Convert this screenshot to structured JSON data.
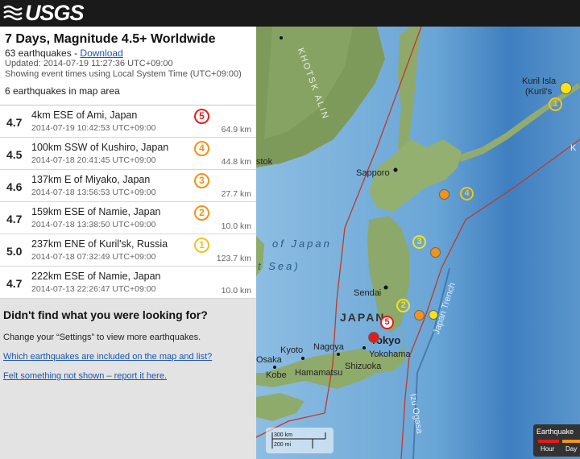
{
  "header": {
    "logo_text": "USGS"
  },
  "summary": {
    "title": "7 Days, Magnitude 4.5+ Worldwide",
    "count_text": "63 earthquakes - ",
    "download_label": "Download",
    "updated": "Updated: 2014-07-19 11:27:36 UTC+09:00",
    "timezone": "Showing event times using Local System Time (UTC+09:00)",
    "in_map_area": "6 earthquakes in map area"
  },
  "earthquakes": [
    {
      "mag": "4.7",
      "place": "4km ESE of Ami, Japan",
      "time": "2014-07-19 10:42:53 UTC+09:00",
      "depth": "64.9 km",
      "num": "5",
      "color": "#e02020"
    },
    {
      "mag": "4.5",
      "place": "100km SSW of Kushiro, Japan",
      "time": "2014-07-18 20:41:45 UTC+09:00",
      "depth": "44.8 km",
      "num": "4",
      "color": "#f39317"
    },
    {
      "mag": "4.6",
      "place": "137km E of Miyako, Japan",
      "time": "2014-07-18 13:56:53 UTC+09:00",
      "depth": "27.7 km",
      "num": "3",
      "color": "#f39317"
    },
    {
      "mag": "4.7",
      "place": "159km ESE of Namie, Japan",
      "time": "2014-07-18 13:38:50 UTC+09:00",
      "depth": "10.0 km",
      "num": "2",
      "color": "#f39317"
    },
    {
      "mag": "5.0",
      "place": "237km ENE of Kuril'sk, Russia",
      "time": "2014-07-18 07:32:49 UTC+09:00",
      "depth": "123.7 km",
      "num": "1",
      "color": "#f3c317"
    },
    {
      "mag": "4.7",
      "place": "222km ESE of Namie, Japan",
      "time": "2014-07-13 22:26:47 UTC+09:00",
      "depth": "10.0 km",
      "num": "",
      "color": "#f3c317"
    }
  ],
  "notfound": {
    "heading": "Didn't find what you were looking for?",
    "settings_text": "Change your “Settings” to view more earthquakes.",
    "link1": "Which earthquakes are included on the map and list?",
    "link2": "Felt something not shown – report it here."
  },
  "map": {
    "labels": {
      "sapporo": "Sapporo",
      "sendai": "Sendai",
      "japan": "JAPAN",
      "tokyo": "Tokyo",
      "yokohama": "Yokohama",
      "nagoya": "Nagoya",
      "kyoto": "Kyoto",
      "osaka": "Osaka",
      "kobe": "Kobe",
      "hamamatsu": "Hamamatsu",
      "shizuoka": "Shizuoka",
      "kuril": "Kuril Isla",
      "kuril2": "(Kuril's",
      "stok": "stok",
      "sea_of_japan": "of Japan",
      "sea2": "t Sea)",
      "trench": "Japan Trench",
      "izu": "Izu Ogasa",
      "ak": "K",
      "okhotsk": "KHOTSK ALIN"
    },
    "scale_km": "300 km",
    "scale_mi": "200 mi",
    "legend_title": "Earthquake",
    "legend_hour": "Hour",
    "legend_day": "Day"
  },
  "colors": {
    "past_hour": "#e41b1b",
    "past_day": "#f39317",
    "past_week": "#f7e31a"
  }
}
